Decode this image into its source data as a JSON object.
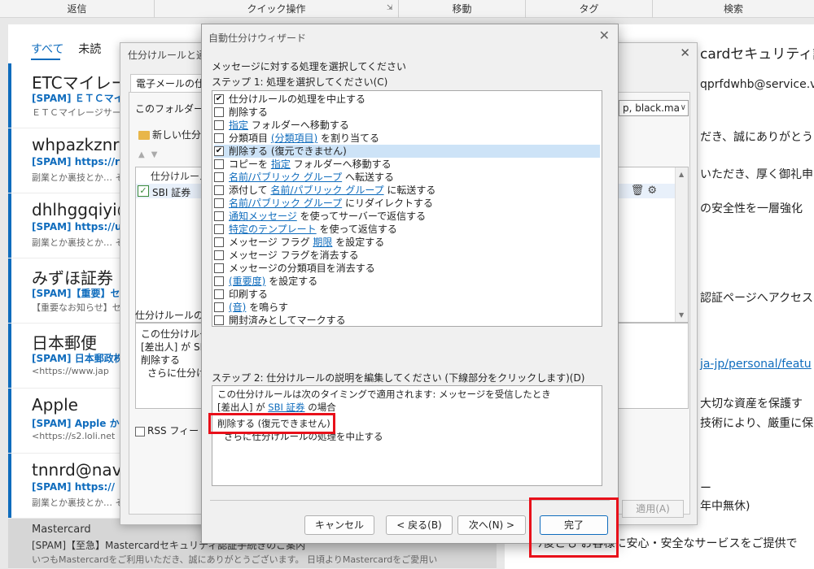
{
  "ribbon": {
    "groups": [
      "返信",
      "クイック操作",
      "移動",
      "タグ",
      "検索"
    ]
  },
  "maillist": {
    "tabs": [
      "すべて",
      "未読"
    ],
    "items": [
      {
        "sender": "ETCマイレージ",
        "subject": "[SPAM] ＥＴＣマイ",
        "preview": "ＥＴＣマイレージサービ"
      },
      {
        "sender": "whpazkznrt",
        "subject": "[SPAM] https://r",
        "preview": "副業とか裏技とか… そ"
      },
      {
        "sender": "dhlhggqiyi@",
        "subject": "[SPAM] https://u",
        "preview": "副業とか裏技とか… そ"
      },
      {
        "sender": "みずほ証券",
        "subject": "[SPAM]【重要】セキ",
        "preview": "【重要なお知らせ】セキュ"
      },
      {
        "sender": "日本郵便",
        "subject": "[SPAM] 日本郵政株",
        "preview": "<https://www.jap"
      },
      {
        "sender": "Apple",
        "subject": "[SPAM] Apple から",
        "preview": "<https://s2.loli.net"
      },
      {
        "sender": "tnnrd@navi",
        "subject": "[SPAM] https://",
        "preview": "副業とか裏技とか… そ"
      },
      {
        "sender": "Mastercard",
        "subject": "[SPAM]【至急】Mastercardセキュリティ認証手続きのご案内",
        "preview": "いつもMastercardをご利用いただき、誠にありがとうございます。 日頃よりMastercardをご愛用い"
      }
    ]
  },
  "reading": {
    "lines": [
      "cardセキュリティ認",
      "qprfdwhb@service.v",
      "だき、誠にありがとう",
      "いただき、厚く御礼申し",
      "の安全性を一層強化",
      "認証ページへアクセスし",
      "ja-jp/personal/featu",
      "大切な資産を保護す",
      "技術により、厳重に保",
      "ー",
      "年中無休)",
      "ｿ後とも お客様に安心・安全なサービスをご提供で"
    ]
  },
  "rules_dialog": {
    "title": "仕分けルールと通知",
    "tab_label": "電子メールの仕分",
    "folder_label": "このフォルダーに変",
    "account_value": "p, black.ma",
    "new_rule_label": "新しい仕分",
    "list_header": "仕分けルール",
    "rule_name": "SBI 証券",
    "desc_label": "仕分けルールの説",
    "desc_lines": [
      "この仕分けルー",
      "[差出人] が SBI",
      "削除する",
      "さらに仕分けル"
    ],
    "rss_label": "RSS フィード",
    "apply_label": "適用(A)"
  },
  "wizard": {
    "title": "自動仕分けウィザード",
    "prompt": "メッセージに対する処理を選択してください",
    "step1_label": "ステップ 1: 処理を選択してください(C)",
    "actions": [
      {
        "checked": true,
        "pre": "仕分けルールの処理を中止する",
        "link": "",
        "post": ""
      },
      {
        "checked": false,
        "pre": "削除する",
        "link": "",
        "post": ""
      },
      {
        "checked": false,
        "pre": "",
        "link": "指定",
        "post": " フォルダーへ移動する"
      },
      {
        "checked": false,
        "pre": "分類項目 ",
        "link": "(分類項目)",
        "post": " を割り当てる"
      },
      {
        "checked": true,
        "pre": "削除する (復元できません)",
        "link": "",
        "post": "",
        "selected": true
      },
      {
        "checked": false,
        "pre": "コピーを ",
        "link": "指定",
        "post": " フォルダーへ移動する"
      },
      {
        "checked": false,
        "pre": "",
        "link": "名前/パブリック グループ",
        "post": " へ転送する"
      },
      {
        "checked": false,
        "pre": "添付して ",
        "link": "名前/パブリック グループ",
        "post": " に転送する"
      },
      {
        "checked": false,
        "pre": "",
        "link": "名前/パブリック グループ",
        "post": " にリダイレクトする"
      },
      {
        "checked": false,
        "pre": "",
        "link": "通知メッセージ",
        "post": " を使ってサーバーで返信する"
      },
      {
        "checked": false,
        "pre": "",
        "link": "特定のテンプレート",
        "post": " を使って返信する"
      },
      {
        "checked": false,
        "pre": "メッセージ フラグ ",
        "link": "期限",
        "post": " を設定する"
      },
      {
        "checked": false,
        "pre": "メッセージ フラグを消去する",
        "link": "",
        "post": ""
      },
      {
        "checked": false,
        "pre": "メッセージの分類項目を消去する",
        "link": "",
        "post": ""
      },
      {
        "checked": false,
        "pre": "",
        "link": "(重要度)",
        "post": " を設定する"
      },
      {
        "checked": false,
        "pre": "印刷する",
        "link": "",
        "post": ""
      },
      {
        "checked": false,
        "pre": "",
        "link": "(音)",
        "post": " を鳴らす"
      },
      {
        "checked": false,
        "pre": "開封済みとしてマークする",
        "link": "",
        "post": ""
      }
    ],
    "step2_label": "ステップ 2: 仕分けルールの説明を編集してください (下線部分をクリックします)(D)",
    "desc": {
      "line1": "この仕分けルールは次のタイミングで適用されます: メッセージを受信したとき",
      "line2_pre": "[差出人] が ",
      "line2_link": "SBI 証券",
      "line2_post": " の場合",
      "line3": "削除する (復元できません)",
      "line4": "さらに仕分けルールの処理を中止する"
    },
    "buttons": {
      "cancel": "キャンセル",
      "back": "< 戻る(B)",
      "next": "次へ(N) >",
      "finish": "完了"
    }
  },
  "colors": {
    "accent": "#0f6cbd",
    "highlight": "#e8101a"
  }
}
